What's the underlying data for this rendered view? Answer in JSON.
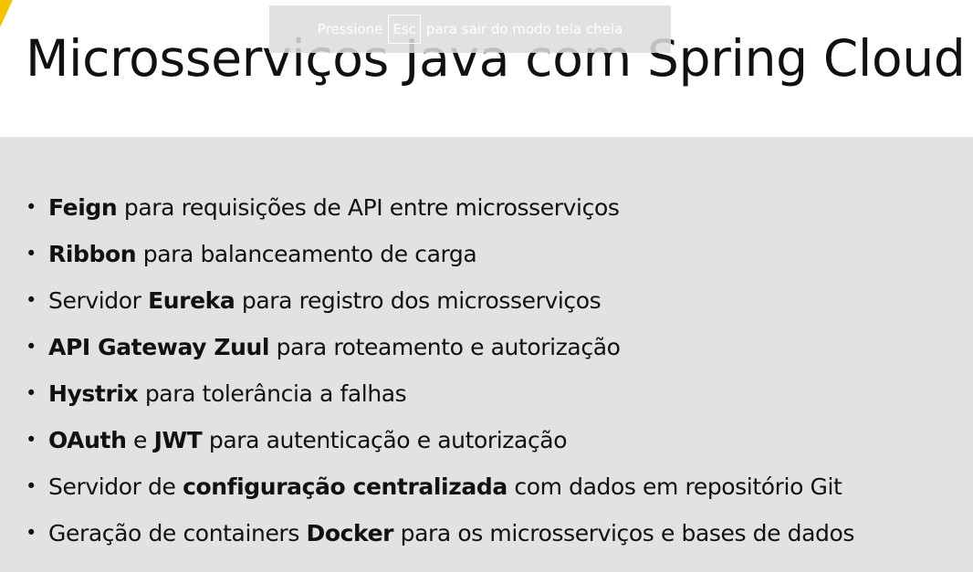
{
  "slide": {
    "title": "Microsserviços Java com Spring Cloud",
    "bullet_symbol": "•",
    "items": [
      {
        "parts": [
          {
            "text": "Feign",
            "bold": true
          },
          {
            "text": " para requisições de API entre microsserviços",
            "bold": false
          }
        ]
      },
      {
        "parts": [
          {
            "text": "Ribbon",
            "bold": true
          },
          {
            "text": " para balanceamento de carga",
            "bold": false
          }
        ]
      },
      {
        "parts": [
          {
            "text": "Servidor ",
            "bold": false
          },
          {
            "text": "Eureka",
            "bold": true
          },
          {
            "text": " para registro dos microsserviços",
            "bold": false
          }
        ]
      },
      {
        "parts": [
          {
            "text": "API Gateway Zuul",
            "bold": true
          },
          {
            "text": " para roteamento e autorização",
            "bold": false
          }
        ]
      },
      {
        "parts": [
          {
            "text": "Hystrix",
            "bold": true
          },
          {
            "text": " para tolerância a falhas",
            "bold": false
          }
        ]
      },
      {
        "parts": [
          {
            "text": "OAuth",
            "bold": true
          },
          {
            "text": " e ",
            "bold": false
          },
          {
            "text": "JWT",
            "bold": true
          },
          {
            "text": " para autenticação e autorização",
            "bold": false
          }
        ]
      },
      {
        "parts": [
          {
            "text": "Servidor de ",
            "bold": false
          },
          {
            "text": "configuração centralizada",
            "bold": true
          },
          {
            "text": " com dados em repositório Git",
            "bold": false
          }
        ]
      },
      {
        "parts": [
          {
            "text": "Geração de containers ",
            "bold": false
          },
          {
            "text": "Docker",
            "bold": true
          },
          {
            "text": " para os microsserviços e bases de dados",
            "bold": false
          }
        ]
      }
    ]
  },
  "fullscreen_notice": {
    "before": "Pressione",
    "key": "Esc",
    "after": "para sair do modo tela cheia"
  },
  "colors": {
    "panel_background": "#e2e2e2",
    "accent": "#f5c400",
    "text": "#111111"
  }
}
